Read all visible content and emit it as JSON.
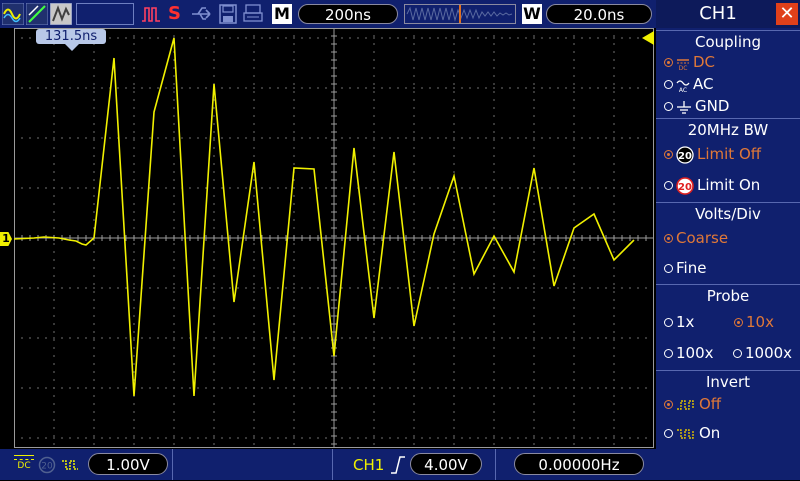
{
  "toolbar": {
    "memory_label": "M",
    "timebase": "200ns",
    "window_label": "W",
    "window_timebase": "20.0ns"
  },
  "scope": {
    "trigger_position_marker": "131.5ns",
    "channel_marker": "1",
    "trace_color": "#f0f000",
    "grid_color": "#9a9a9a"
  },
  "status": {
    "coupling_symbol": "DC",
    "ch1_scale": "1.00V",
    "trigger_source": "CH1",
    "trigger_level": "4.00V",
    "frequency": "0.00000Hz"
  },
  "menu": {
    "title": "CH1",
    "coupling": {
      "heading": "Coupling",
      "options": [
        {
          "label": "DC",
          "selected": true
        },
        {
          "label": "AC",
          "selected": false
        },
        {
          "label": "GND",
          "selected": false
        }
      ]
    },
    "bw": {
      "heading": "20MHz BW",
      "options": [
        {
          "label": "Limit Off",
          "selected": true
        },
        {
          "label": "Limit On",
          "selected": false
        }
      ]
    },
    "volts": {
      "heading": "Volts/Div",
      "options": [
        {
          "label": "Coarse",
          "selected": true
        },
        {
          "label": "Fine",
          "selected": false
        }
      ]
    },
    "probe": {
      "heading": "Probe",
      "options": [
        {
          "label": "1x",
          "selected": false
        },
        {
          "label": "10x",
          "selected": true
        },
        {
          "label": "100x",
          "selected": false
        },
        {
          "label": "1000x",
          "selected": false
        }
      ]
    },
    "invert": {
      "heading": "Invert",
      "options": [
        {
          "label": "Off",
          "selected": true
        },
        {
          "label": "On",
          "selected": false
        }
      ]
    }
  }
}
